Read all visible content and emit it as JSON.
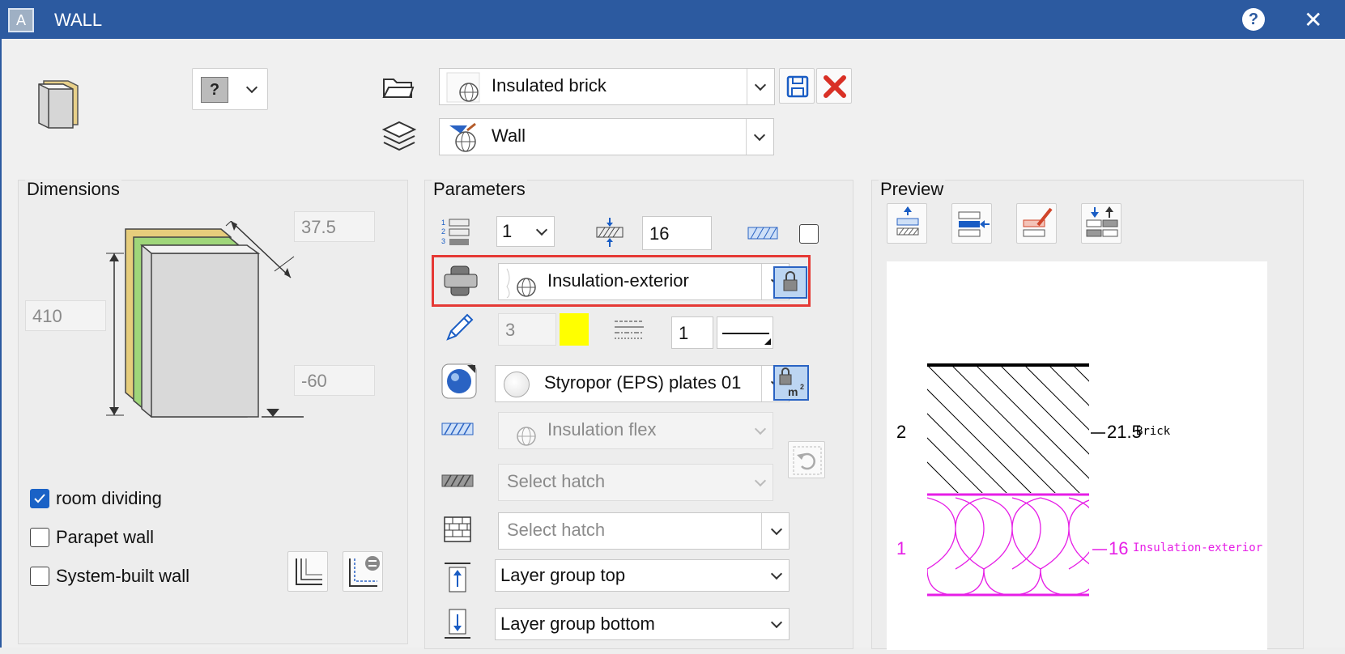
{
  "window": {
    "title": "WALL",
    "app_icon_letter": "A"
  },
  "header": {
    "style_selector": {
      "value": "Insulated brick"
    },
    "layer_selector": {
      "value": "Wall"
    }
  },
  "dimensions": {
    "title": "Dimensions",
    "depth": "37.5",
    "height": "410",
    "offset": "-60",
    "checkboxes": [
      {
        "label": "room dividing",
        "checked": true
      },
      {
        "label": "Parapet wall",
        "checked": false
      },
      {
        "label": "System-built wall",
        "checked": false
      }
    ]
  },
  "parameters": {
    "title": "Parameters",
    "layer_number": "1",
    "thickness": "16",
    "material": "Insulation-exterior",
    "pen_value": "3",
    "pen_color": "#ffff00",
    "line_value": "1",
    "surface": "Styropor (EPS) plates 01",
    "hatch1": "Insulation flex",
    "hatch2": "Select hatch",
    "hatch3": "Select hatch",
    "layer_group_top": "Layer group top",
    "layer_group_bottom": "Layer group bottom",
    "highlight_color": "#e53935"
  },
  "preview": {
    "title": "Preview",
    "layers": [
      {
        "index": "2",
        "thickness": "21.5",
        "name": "Brick",
        "color": "#000000"
      },
      {
        "index": "1",
        "thickness": "16",
        "name": "Insulation-exterior",
        "color": "#e61ee6"
      }
    ]
  }
}
